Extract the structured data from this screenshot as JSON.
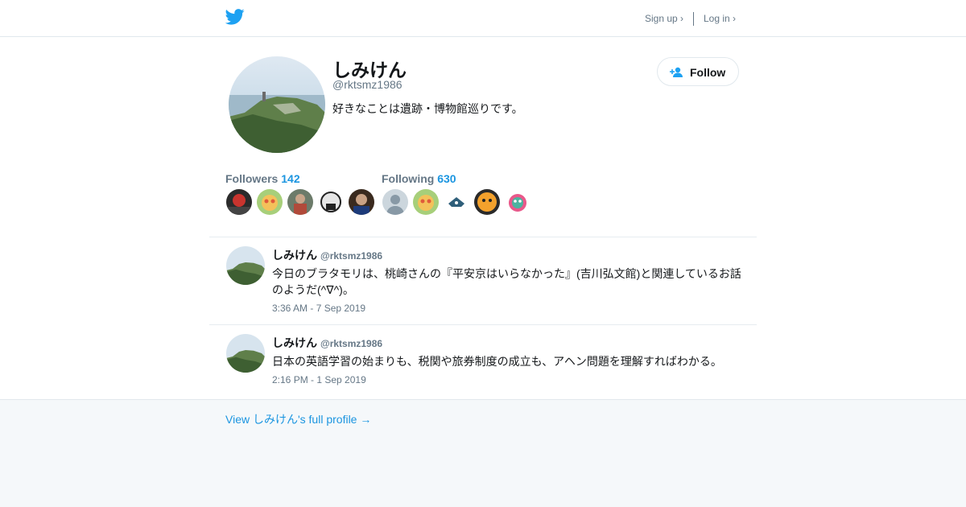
{
  "header": {
    "signup_label": "Sign up ›",
    "login_label": "Log in ›",
    "brand_color": "#1da1f2"
  },
  "profile": {
    "name": "しみけん",
    "handle": "@rktsmz1986",
    "bio": "好きなことは遺跡・博物館巡りです。",
    "follow_label": "Follow"
  },
  "stats": {
    "followers_label": "Followers",
    "followers_count": "142",
    "following_label": "Following",
    "following_count": "630"
  },
  "tweets": [
    {
      "name": "しみけん",
      "handle": "@rktsmz1986",
      "text": "今日のブラタモリは、桃崎さんの『平安京はいらなかった』(吉川弘文館)と関連しているお話のようだ(^∇^)。",
      "time": "3:36 AM - 7 Sep 2019"
    },
    {
      "name": "しみけん",
      "handle": "@rktsmz1986",
      "text": "日本の英語学習の始まりも、税関や旅券制度の成立も、アヘン問題を理解すればわかる。",
      "time": "2:16 PM - 1 Sep 2019"
    }
  ],
  "footer": {
    "profile_link": "View しみけん's full profile →"
  }
}
